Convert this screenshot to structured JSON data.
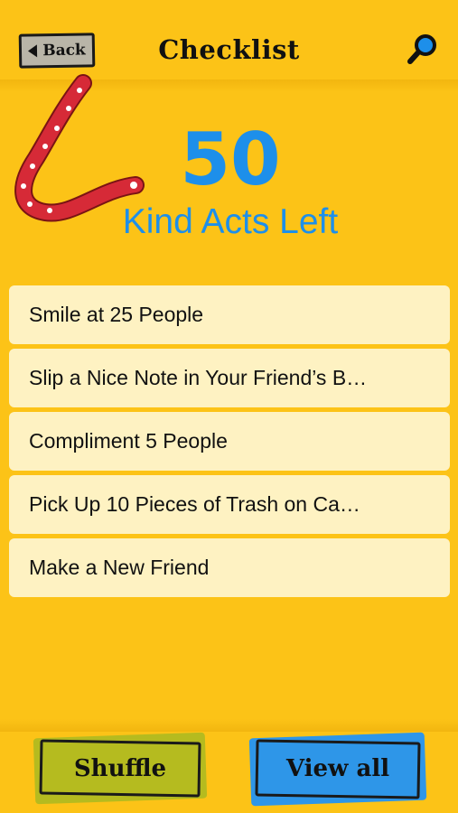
{
  "header": {
    "back_label": "Back",
    "title": "Checklist"
  },
  "summary": {
    "count": "50",
    "label": "Kind Acts Left"
  },
  "checklist": {
    "items": [
      {
        "label": "Smile at 25 People"
      },
      {
        "label": "Slip a Nice Note in Your Friend’s B…"
      },
      {
        "label": "Compliment 5 People"
      },
      {
        "label": "Pick Up 10 Pieces of Trash on Ca…"
      },
      {
        "label": "Make a New Friend"
      }
    ]
  },
  "footer": {
    "shuffle_label": "Shuffle",
    "view_all_label": "View all"
  },
  "colors": {
    "background": "#FCC317",
    "accent_blue": "#1D8FEA",
    "item_bg": "#FEF2C2",
    "shuffle_green": "#B5BB1F",
    "ribbon_red": "#D62A37"
  },
  "icons": {
    "back": "left-triangle-icon",
    "search": "magnifier-icon",
    "ribbon": "ribbon-decoration"
  }
}
